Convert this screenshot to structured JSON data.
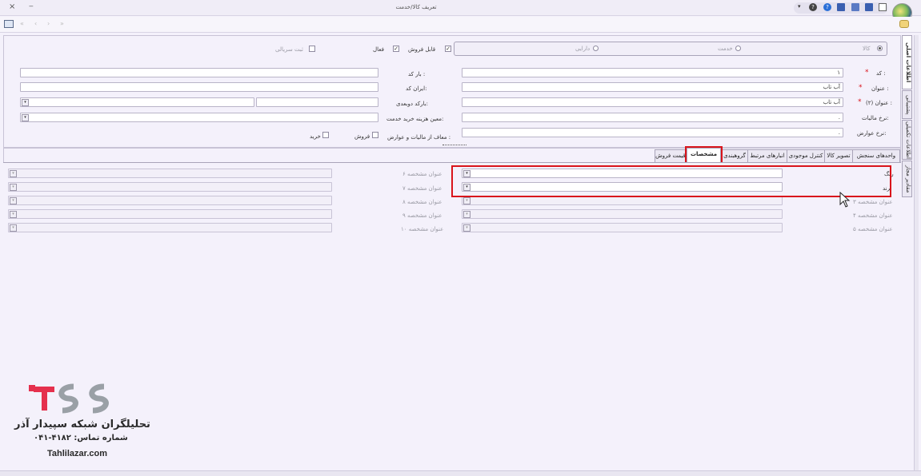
{
  "window": {
    "title": "تعریف کالا/خدمت",
    "close": "×",
    "minimize": "‒"
  },
  "nav_buttons": [
    "«",
    "‹",
    "›",
    "»"
  ],
  "type_radio": {
    "options": [
      "کالا",
      "خدمت",
      "دارایی"
    ]
  },
  "checks": {
    "sellable": "قابل فروش",
    "active": "فعال",
    "serial": "ثبت سریالی"
  },
  "form": {
    "code_label": "کد :",
    "code_value": "۱",
    "title_label": "عنوان :",
    "title_value": "آب تاب",
    "title2_label": "عنوان (۲) :",
    "title2_value": "آب تاب",
    "tax_rate_label": "نرخ مالیات:",
    "duty_rate_label": "نرخ عوارض:",
    "barcode_label": "بار کد :",
    "iran_code_label": "ایران کد:",
    "barcode2_label": "بارکد دوبعدی:",
    "cost_center_label": "معین هزینه خرید خدمت:",
    "exempt_label": "معاف از مالیات و عوارض :",
    "exempt_sell": "فروش",
    "exempt_buy": "خرید",
    "required_mark": "*",
    "dot": "."
  },
  "tabs": [
    "واحدهای سنجش",
    "تصویر کالا",
    "کنترل موجودی",
    "انبارهای مرتبط",
    "گروهبندی",
    "مشخصات",
    "قیمت فروش"
  ],
  "side_tabs": [
    "اطلاعات اصلی",
    "پشتیبانی",
    "اطلاعات تکمیلی",
    "مقادیر مجاز"
  ],
  "specs": {
    "right": [
      {
        "label": "رنگ",
        "enabled": true
      },
      {
        "label": "برند",
        "enabled": true
      },
      {
        "label": "عنوان مشخصه ۳",
        "enabled": false
      },
      {
        "label": "عنوان مشخصه ۴",
        "enabled": false
      },
      {
        "label": "عنوان مشخصه ۵",
        "enabled": false
      }
    ],
    "left": [
      {
        "label": "عنوان مشخصه ۶"
      },
      {
        "label": "عنوان مشخصه ۷"
      },
      {
        "label": "عنوان مشخصه ۸"
      },
      {
        "label": "عنوان مشخصه ۹"
      },
      {
        "label": "عنوان مشخصه ۱۰"
      }
    ]
  },
  "watermark": {
    "company": "تحلیلگران شبکه سپیدار آذر",
    "phone": "شماره تماس: ۴۱۸۲-۰۴۱",
    "site": "Tahlilazar.com"
  },
  "colors": {
    "highlight": "#d9141b",
    "brand_red": "#e5304d",
    "brand_gray": "#9aa0a6",
    "bg": "#f4f1fb"
  }
}
